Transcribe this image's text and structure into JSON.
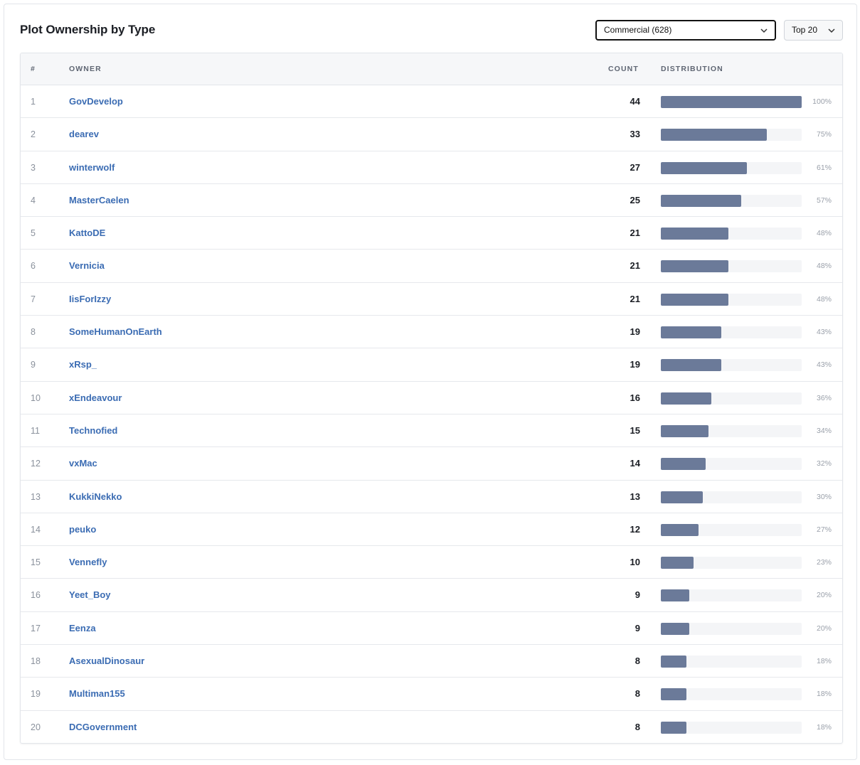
{
  "panel": {
    "title": "Plot Ownership by Type",
    "type_filter": "Commercial (628)",
    "limit_filter": "Top 20"
  },
  "table": {
    "columns": {
      "idx": "#",
      "owner": "OWNER",
      "count": "COUNT",
      "distribution": "DISTRIBUTION"
    },
    "rows": [
      {
        "rank": "1",
        "owner": "GovDevelop",
        "count": "44",
        "pct": "100%",
        "fraction": 1.0
      },
      {
        "rank": "2",
        "owner": "dearev",
        "count": "33",
        "pct": "75%",
        "fraction": 0.75
      },
      {
        "rank": "3",
        "owner": "winterwolf",
        "count": "27",
        "pct": "61%",
        "fraction": 0.61
      },
      {
        "rank": "4",
        "owner": "MasterCaelen",
        "count": "25",
        "pct": "57%",
        "fraction": 0.57
      },
      {
        "rank": "5",
        "owner": "KattoDE",
        "count": "21",
        "pct": "48%",
        "fraction": 0.48
      },
      {
        "rank": "6",
        "owner": "Vernicia",
        "count": "21",
        "pct": "48%",
        "fraction": 0.48
      },
      {
        "rank": "7",
        "owner": "IisForIzzy",
        "count": "21",
        "pct": "48%",
        "fraction": 0.48
      },
      {
        "rank": "8",
        "owner": "SomeHumanOnEarth",
        "count": "19",
        "pct": "43%",
        "fraction": 0.43
      },
      {
        "rank": "9",
        "owner": "xRsp_",
        "count": "19",
        "pct": "43%",
        "fraction": 0.43
      },
      {
        "rank": "10",
        "owner": "xEndeavour",
        "count": "16",
        "pct": "36%",
        "fraction": 0.36
      },
      {
        "rank": "11",
        "owner": "Technofied",
        "count": "15",
        "pct": "34%",
        "fraction": 0.34
      },
      {
        "rank": "12",
        "owner": "vxMac",
        "count": "14",
        "pct": "32%",
        "fraction": 0.32
      },
      {
        "rank": "13",
        "owner": "KukkiNekko",
        "count": "13",
        "pct": "30%",
        "fraction": 0.3
      },
      {
        "rank": "14",
        "owner": "peuko",
        "count": "12",
        "pct": "27%",
        "fraction": 0.27
      },
      {
        "rank": "15",
        "owner": "Vennefly",
        "count": "10",
        "pct": "23%",
        "fraction": 0.23
      },
      {
        "rank": "16",
        "owner": "Yeet_Boy",
        "count": "9",
        "pct": "20%",
        "fraction": 0.2
      },
      {
        "rank": "17",
        "owner": "Eenza",
        "count": "9",
        "pct": "20%",
        "fraction": 0.2
      },
      {
        "rank": "18",
        "owner": "AsexualDinosaur",
        "count": "8",
        "pct": "18%",
        "fraction": 0.18
      },
      {
        "rank": "19",
        "owner": "Multiman155",
        "count": "8",
        "pct": "18%",
        "fraction": 0.18
      },
      {
        "rank": "20",
        "owner": "DCGovernment",
        "count": "8",
        "pct": "18%",
        "fraction": 0.18
      }
    ]
  },
  "icons": {
    "dropdown": "chevron-down-icon"
  },
  "colors": {
    "link": "#3b6cb3",
    "bar_fill": "#6b7a99",
    "bar_track": "#f4f5f7"
  }
}
